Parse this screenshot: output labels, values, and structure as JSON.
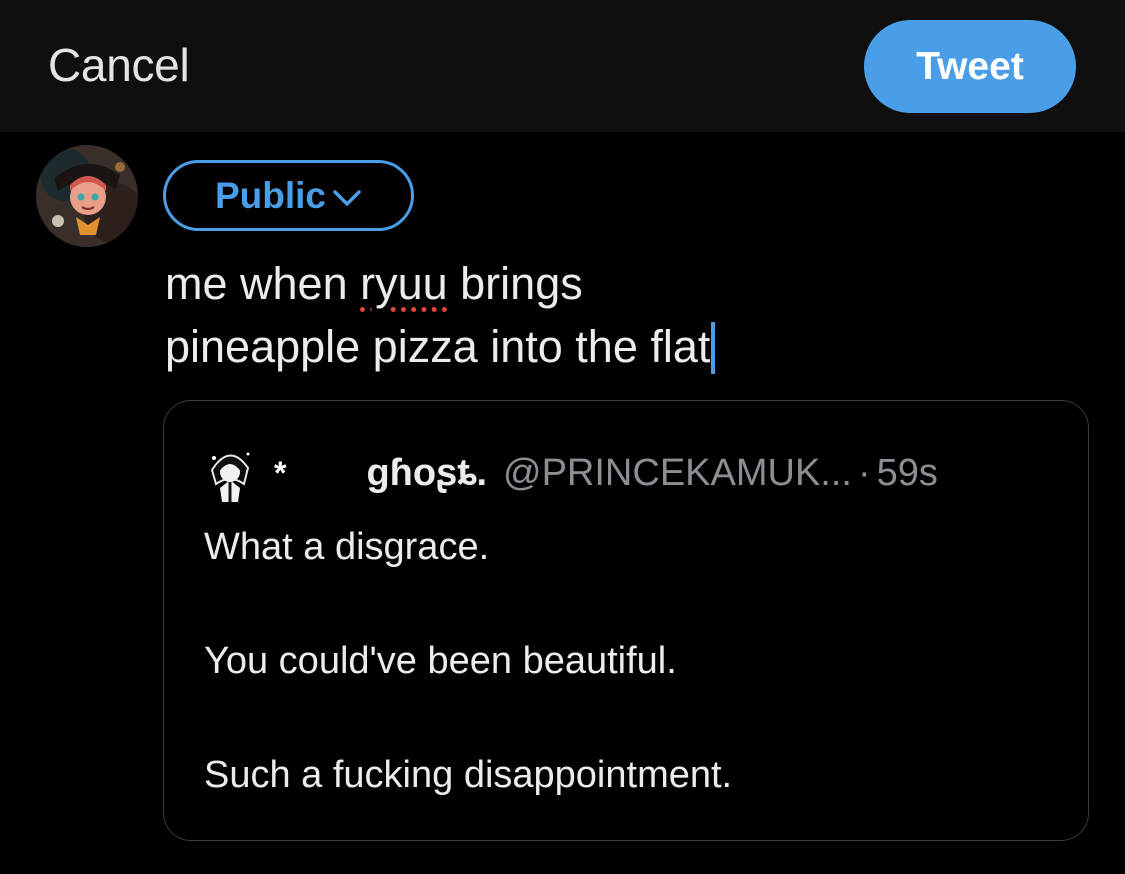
{
  "header": {
    "cancel_label": "Cancel",
    "tweet_label": "Tweet",
    "accent_color": "#4a9de7"
  },
  "composer": {
    "audience_label": "Public",
    "audience_icon": "chevron-down-icon",
    "text_before_misspelled": "me when ",
    "misspelled_word": "ryuu",
    "text_after_misspelled": " brings",
    "text_line2": "pineapple pizza into the flat"
  },
  "quoted_tweet": {
    "star": "*",
    "display_name": "gɦoʂȶ.",
    "handle": "@PRINCEKAMUK...",
    "separator": "·",
    "time": "59s",
    "lines": [
      "What a disgrace.",
      "You could've been beautiful.",
      "Such a fucking disappointment."
    ]
  }
}
